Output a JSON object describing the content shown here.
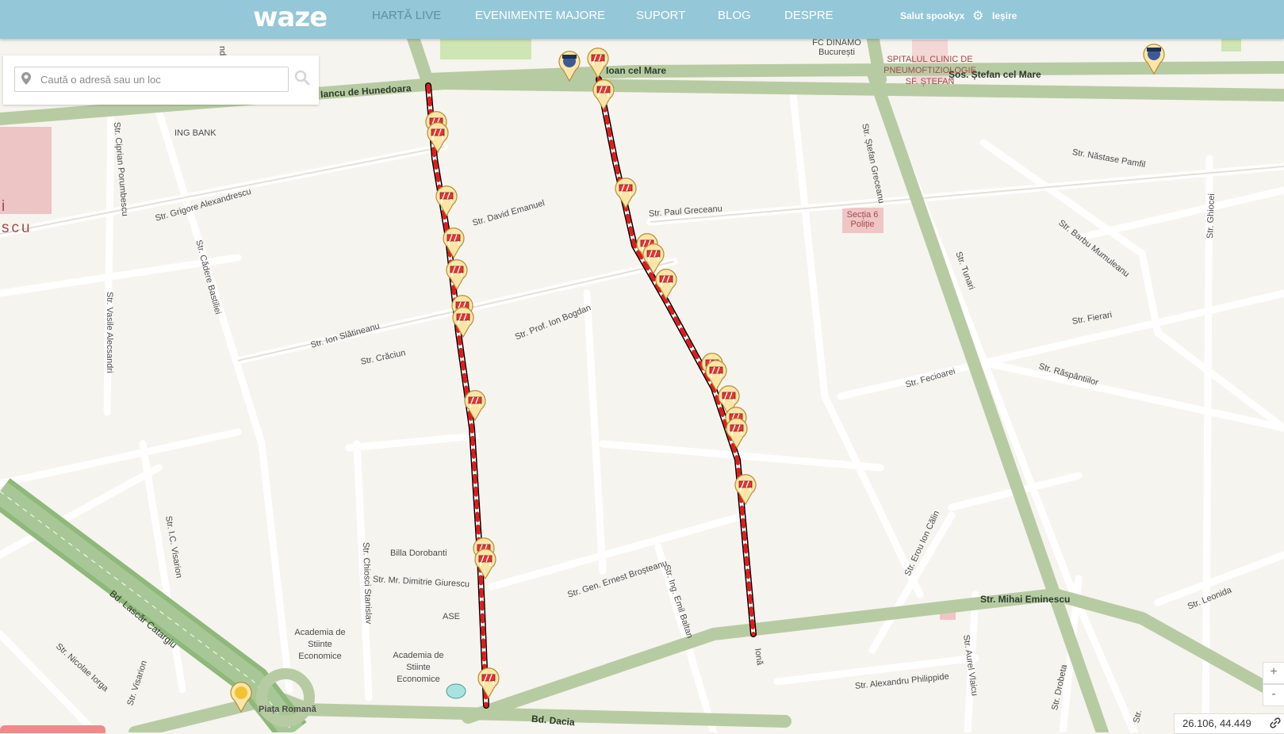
{
  "header": {
    "logo": "waze",
    "nav": [
      "HARTĂ LIVE",
      "EVENIMENTE MAJORE",
      "SUPORT",
      "BLOG",
      "DESPRE"
    ],
    "active_nav": "HARTĂ LIVE",
    "greeting": "Salut spookyx",
    "logout": "Ieșire"
  },
  "search": {
    "placeholder": "Caută o adresă sau un loc"
  },
  "map": {
    "coords": "26.106, 44.449",
    "zoom_in": "+",
    "zoom_out": "-",
    "streets": [
      "Str. Grigore Alexandrescu",
      "Str. David Emanuel",
      "Str. Paul Greceanu",
      "Str. Ion Slătineanu",
      "Str. Crăciun",
      "Str. Prof. Ion Bogdan",
      "Str. Cădere Bastiliei",
      "Str. Vasile Alecsandri",
      "Str. Ciprian Porumbescu",
      "Str. Ștefan Greceanu",
      "Str. Tunari",
      "Str. Năstase Pamfil",
      "Str. Barbu Mumuleanu",
      "Str. Ghiocei",
      "Str. Fierari",
      "Str. Fecioarei",
      "Str. Răspântiilor",
      "Str. Mihai Eminescu",
      "Str. Leonida",
      "Str. Erou Ion Călin",
      "Str. Aurel Vlaicu",
      "Str. Alexandru Philippide",
      "Str. Drobeta",
      "Str. Gen. Ernest Broșteanu",
      "Str. Ing. Emil Baltan",
      "Str. Chiosci Stanislav",
      "Str. Mr. Dimitrie Giurescu",
      "Str. I.C. Visarion",
      "Str. Visarion",
      "Str. Nicolae Iorga",
      "Bd. Lascăr Catargiu",
      "Bd. Dacia",
      "Ioan cel Mare",
      "Șos. Ștefan cel Mare",
      "Iancu de Hunedoara",
      "Piața Romană"
    ],
    "pois": [
      "ING BANK",
      "FC DINAMO București",
      "SPITALUL CLINIC DE PNEUMOFTIZIOLOGIE SF. ȘTEFAN",
      "Secția 6 Poliție",
      "Billa Dorobanti",
      "ASE",
      "Academia de Stiinte Economice",
      "Academia de Stiinte Economice"
    ],
    "extra_labels": [
      "scu",
      "i",
      "Ionă",
      "Str.",
      "nda"
    ]
  }
}
